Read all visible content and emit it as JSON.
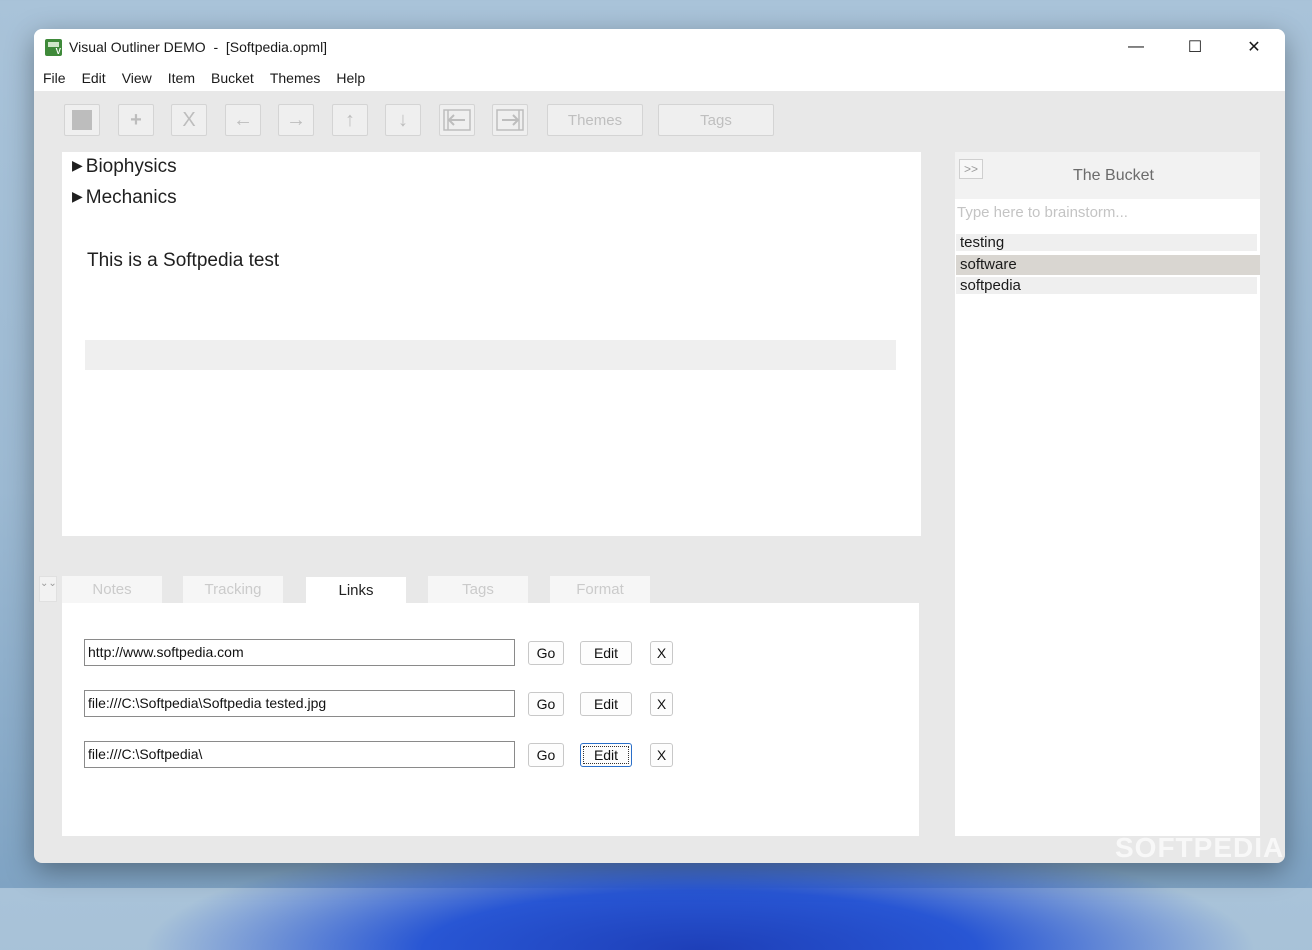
{
  "window": {
    "title": "Visual Outliner DEMO  -  [Softpedia.opml]",
    "controls": {
      "minimize": "—",
      "maximize": "☐",
      "close": "✕"
    }
  },
  "menu": [
    "File",
    "Edit",
    "View",
    "Item",
    "Bucket",
    "Themes",
    "Help"
  ],
  "toolbar": {
    "add": "+",
    "delete": "X",
    "left": "←",
    "right": "→",
    "up": "↑",
    "down": "↓",
    "themes": "Themes",
    "tags": "Tags"
  },
  "outline": {
    "nodes": [
      {
        "label": "Biophysics",
        "arrow": "▶"
      },
      {
        "label": "Mechanics",
        "arrow": "▶"
      }
    ],
    "item_text": "This is a Softpedia test"
  },
  "tabs": {
    "collapse": "⌄⌄",
    "items": [
      "Notes",
      "Tracking",
      "Links",
      "Tags",
      "Format"
    ],
    "active": "Links"
  },
  "links": [
    {
      "url": "http://www.softpedia.com"
    },
    {
      "url": "file:///C:\\Softpedia\\Softpedia tested.jpg"
    },
    {
      "url": "file:///C:\\Softpedia\\"
    }
  ],
  "link_buttons": {
    "go": "Go",
    "edit": "Edit",
    "remove": "X"
  },
  "bucket": {
    "toggle": ">>",
    "title": "The Bucket",
    "placeholder": "Type here to brainstorm...",
    "items": [
      "testing",
      "software",
      "softpedia"
    ],
    "selected": "software"
  },
  "watermark": "SOFTPEDIA"
}
